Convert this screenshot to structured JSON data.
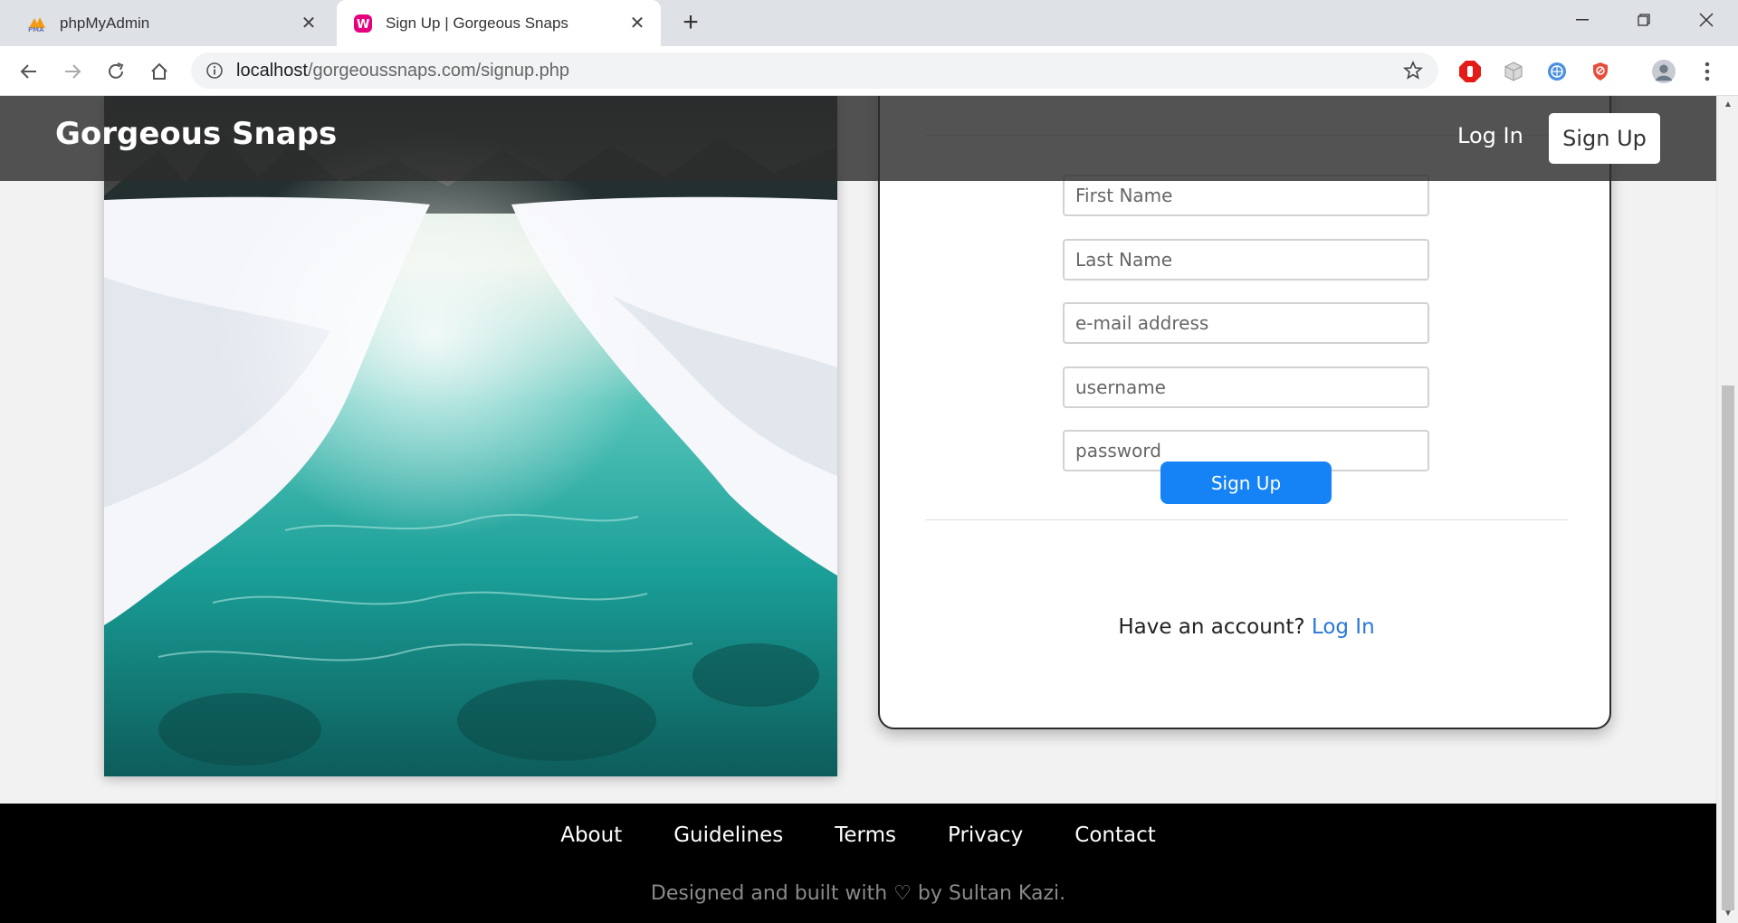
{
  "browser": {
    "tabs": [
      {
        "title": "phpMyAdmin",
        "icon": "phpmyadmin-icon",
        "active": false
      },
      {
        "title": "Sign Up | Gorgeous Snaps",
        "icon": "wamp-icon",
        "active": true
      }
    ],
    "url_host": "localhost",
    "url_path": "/gorgeoussnaps.com/signup.php"
  },
  "header": {
    "brand": "Gorgeous Snaps",
    "login_label": "Log In",
    "signup_label": "Sign Up"
  },
  "form": {
    "first_name_placeholder": "First Name",
    "last_name_placeholder": "Last Name",
    "email_placeholder": "e-mail address",
    "username_placeholder": "username",
    "password_placeholder": "password",
    "submit_label": "Sign Up",
    "have_account_text": "Have an account?",
    "login_link": "Log In"
  },
  "footer": {
    "links": [
      "About",
      "Guidelines",
      "Terms",
      "Privacy",
      "Contact"
    ],
    "credit": "Designed and built with ♡ by Sultan Kazi."
  },
  "colors": {
    "accent": "#1583f5",
    "link": "#2b77d8",
    "header_bg": "#2d2d2d",
    "footer_bg": "#000000"
  }
}
